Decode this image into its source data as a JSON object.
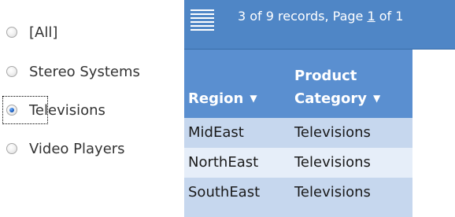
{
  "filter": {
    "options": [
      {
        "label": "[All]",
        "checked": false
      },
      {
        "label": "Stereo Systems",
        "checked": false
      },
      {
        "label": "Televisions",
        "checked": true
      },
      {
        "label": "Video Players",
        "checked": false
      }
    ]
  },
  "grid": {
    "menu_icon": "hamburger-icon",
    "records_prefix": "3 of 9 records, Page ",
    "page_number": "1",
    "records_suffix": " of 1",
    "columns": {
      "region": "Region",
      "product_line1": "Product",
      "product_line2": "Category",
      "sort_icon": "▼"
    },
    "rows": [
      {
        "region": "MidEast",
        "product": "Televisions"
      },
      {
        "region": "NorthEast",
        "product": "Televisions"
      },
      {
        "region": "SouthEast",
        "product": "Televisions"
      }
    ],
    "colors": {
      "header": "#4f86c6",
      "column_header": "#5a8fd0",
      "row_dark": "#c6d7ee",
      "row_light": "#e6eef9"
    }
  }
}
